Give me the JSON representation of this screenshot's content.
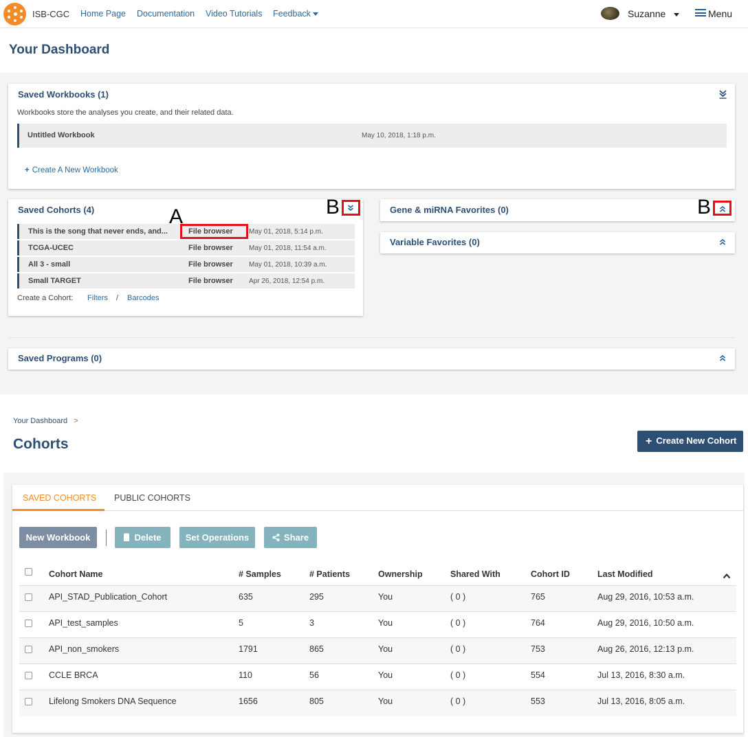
{
  "nav": {
    "brand": "ISB-CGC",
    "links": [
      "Home Page",
      "Documentation",
      "Video Tutorials",
      "Feedback"
    ],
    "user": "Suzanne",
    "menu": "Menu"
  },
  "dashboard": {
    "title": "Your Dashboard",
    "workbooks": {
      "title": "Saved Workbooks (1)",
      "description": "Workbooks store the analyses you create, and their related data.",
      "items": [
        {
          "name": "Untitled Workbook",
          "date": "May 10, 2018, 1:18 p.m."
        }
      ],
      "create": "Create A New Workbook"
    },
    "cohorts": {
      "title": "Saved Cohorts (4)",
      "items": [
        {
          "name": "This is the song that never ends, and...",
          "link": "File browser",
          "date": "May 01, 2018, 5:14 p.m."
        },
        {
          "name": "TCGA-UCEC",
          "link": "File browser",
          "date": "May 01, 2018, 11:54 a.m."
        },
        {
          "name": "All 3 - small",
          "link": "File browser",
          "date": "May 01, 2018, 10:39 a.m."
        },
        {
          "name": "Small TARGET",
          "link": "File browser",
          "date": "Apr 26, 2018, 12:54 p.m."
        }
      ],
      "create_label": "Create a Cohort:",
      "filters": "Filters",
      "slash": "/",
      "barcodes": "Barcodes"
    },
    "gene_favorites": {
      "title": "Gene & miRNA Favorites (0)"
    },
    "variable_favorites": {
      "title": "Variable Favorites (0)"
    },
    "programs": {
      "title": "Saved Programs (0)"
    },
    "annotations": {
      "A": "A",
      "B1": "B",
      "B2": "B"
    }
  },
  "cohorts_page": {
    "breadcrumb": "Your Dashboard",
    "breadcrumb_sep": ">",
    "title": "Cohorts",
    "create_button": "Create New Cohort",
    "tabs": [
      "SAVED COHORTS",
      "PUBLIC COHORTS"
    ],
    "buttons": {
      "new_workbook": "New Workbook",
      "delete": "Delete",
      "set_operations": "Set Operations",
      "share": "Share"
    },
    "columns": [
      "Cohort Name",
      "# Samples",
      "# Patients",
      "Ownership",
      "Shared With",
      "Cohort ID",
      "Last Modified"
    ],
    "rows": [
      {
        "name": "API_STAD_Publication_Cohort",
        "samples": "635",
        "patients": "295",
        "ownership": "You",
        "shared": "( 0 )",
        "id": "765",
        "modified": "Aug 29, 2016, 10:53 a.m."
      },
      {
        "name": "API_test_samples",
        "samples": "5",
        "patients": "3",
        "ownership": "You",
        "shared": "( 0 )",
        "id": "764",
        "modified": "Aug 29, 2016, 10:50 a.m."
      },
      {
        "name": "API_non_smokers",
        "samples": "1791",
        "patients": "865",
        "ownership": "You",
        "shared": "( 0 )",
        "id": "753",
        "modified": "Aug 26, 2016, 12:13 p.m."
      },
      {
        "name": "CCLE BRCA",
        "samples": "110",
        "patients": "56",
        "ownership": "You",
        "shared": "( 0 )",
        "id": "554",
        "modified": "Jul 13, 2016, 8:30 a.m."
      },
      {
        "name": "Lifelong Smokers DNA Sequence",
        "samples": "1656",
        "patients": "805",
        "ownership": "You",
        "shared": "( 0 )",
        "id": "553",
        "modified": "Jul 13, 2016, 8:05 a.m."
      }
    ]
  },
  "colors": {
    "brand": "#f28c28",
    "heading": "#2d4f73",
    "link": "#2a6a9e",
    "annotation": "#e3101a"
  },
  "icons": [
    "isb-cgc-logo-icon",
    "caret-down-icon",
    "avatar",
    "hamburger-icon",
    "double-chevron-down-icon",
    "double-chevron-up-icon",
    "plus-icon",
    "trash-icon",
    "share-icon",
    "chevron-up-icon"
  ]
}
